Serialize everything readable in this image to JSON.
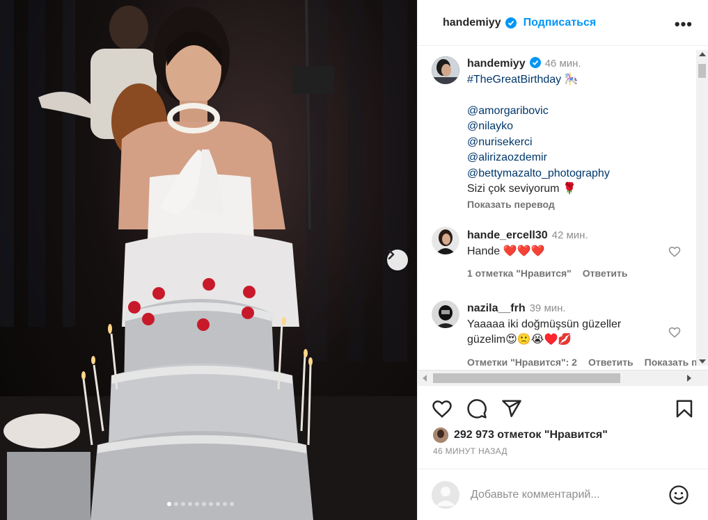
{
  "post": {
    "author": "handemiyy",
    "follow_label": "Подписаться",
    "more_label": "•••"
  },
  "caption": {
    "username": "handemiyy",
    "time": "46 мин.",
    "hashtag": "#TheGreatBirthday",
    "mentions": [
      "@amorgaribovic",
      "@nilayko",
      "@nurisekerci",
      "@alirizaozdemir",
      "@bettymazalto_photography"
    ],
    "text": "Sizi çok seviyorum",
    "translate": "Показать перевод"
  },
  "comments": [
    {
      "username": "hande_ercell30",
      "time": "42 мин.",
      "text": "Hande",
      "emojis": [
        "heart",
        "heart",
        "heart"
      ],
      "likes": "1 отметка \"Нравится\"",
      "reply": "Ответить"
    },
    {
      "username": "nazila__frh",
      "time": "39 мин.",
      "text_line1": "Yaaaaa iki doğmüşsün güzeller",
      "text_line2": "güzelim",
      "likes": "Отметки \"Нравится\": 2",
      "reply": "Ответить",
      "translate": "Показать п"
    }
  ],
  "actions": {
    "like_count": "292 973 отметок \"Нравится\"",
    "time_ago": "46 МИНУТ НАЗАД"
  },
  "comment_input": {
    "placeholder": "Добавьте комментарий..."
  },
  "icons": [
    "verified-icon",
    "more-icon",
    "heart-icon",
    "comment-icon",
    "share-icon",
    "save-icon",
    "emoji-icon",
    "chevron-right-icon"
  ],
  "colors": {
    "link": "#0095f6",
    "mention": "#00376b",
    "secondary": "#8e8e8e",
    "emoji_heart": "#ed4956"
  },
  "carousel": {
    "slides": 10,
    "active_index": 0
  }
}
